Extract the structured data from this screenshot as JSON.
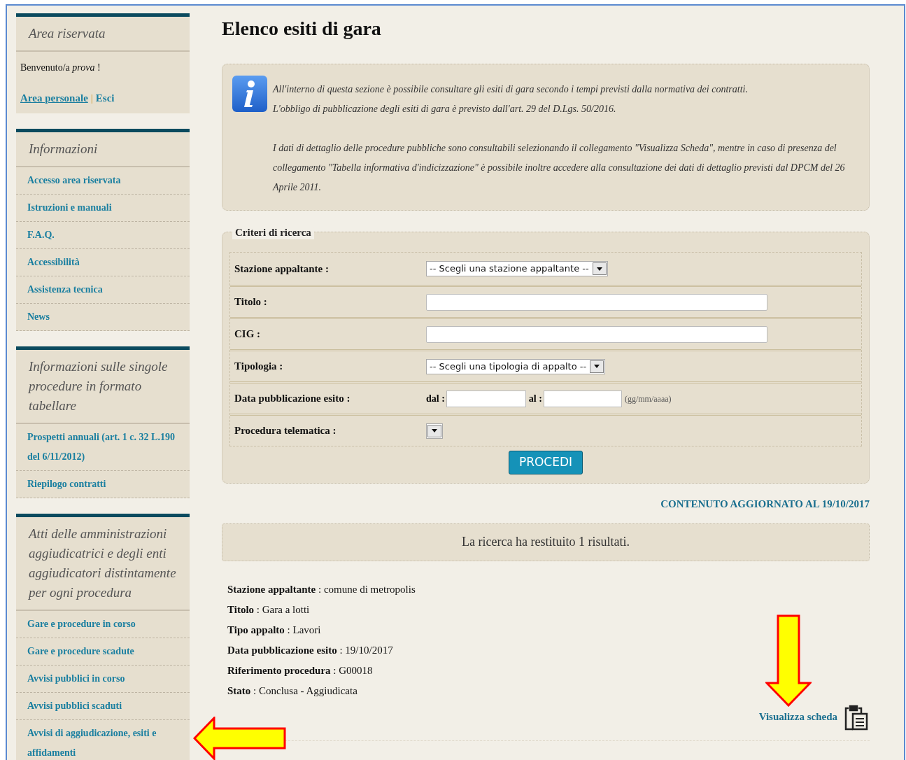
{
  "sidebar": {
    "panels": [
      {
        "kind": "login",
        "title": "Area riservata",
        "welcome": "Benvenuto/a *prova* !",
        "links": [
          "Area personale",
          "Esci"
        ],
        "separator": "|"
      },
      {
        "kind": "menu",
        "title": "Informazioni",
        "items": [
          "Accesso area riservata",
          "Istruzioni e manuali",
          "F.A.Q.",
          "Accessibilità",
          "Assistenza tecnica",
          "News"
        ]
      },
      {
        "kind": "menu",
        "title": "Informazioni sulle singole procedure in formato tabellare",
        "items": [
          "Prospetti annuali (art. 1 c. 32 L.190 del 6/11/2012)",
          "Riepilogo contratti"
        ]
      },
      {
        "kind": "menu",
        "title": "Atti delle amministrazioni aggiudicatrici e degli enti aggiudicatori distintamente per ogni procedura",
        "items": [
          "Gare e procedure in corso",
          "Gare e procedure scadute",
          "Avvisi pubblici in corso",
          "Avvisi pubblici scaduti",
          "Avvisi di aggiudicazione, esiti e affidamenti"
        ]
      }
    ]
  },
  "page_title": "Elenco esiti di gara",
  "info": {
    "paragraphs": [
      "All'interno di questa sezione è possibile consultare gli esiti di gara secondo i tempi previsti dalla normativa dei contratti.\nL'obbligo di pubblicazione degli esiti di gara è previsto dall'art. 29 del D.Lgs. 50/2016.",
      "I dati di dettaglio delle procedure pubbliche sono consultabili selezionando il collegamento \"Visualizza Scheda\", mentre in caso di presenza del collegamento \"Tabella informativa d'indicizzazione\" è possibile inoltre accedere alla consultazione dei dati di dettaglio previsti dal DPCM del 26 Aprile 2011."
    ]
  },
  "search_form": {
    "legend": "Criteri di ricerca",
    "fields": [
      {
        "kind": "select",
        "label": "Stazione appaltante :",
        "value": "-- Scegli una stazione appaltante --"
      },
      {
        "kind": "text",
        "label": "Titolo :"
      },
      {
        "kind": "text",
        "label": "CIG :"
      },
      {
        "kind": "select",
        "label": "Tipologia :",
        "value": "-- Scegli una tipologia di appalto --"
      },
      {
        "kind": "daterange",
        "label": "Data pubblicazione esito :",
        "from_label": "dal :",
        "to_label": "al :",
        "hint": "(gg/mm/aaaa)"
      },
      {
        "kind": "select",
        "label": "Procedura telematica :"
      }
    ],
    "button": "PROCEDI"
  },
  "updated_note": "CONTENUTO AGGIORNATO AL 19/10/2017",
  "result_message": "La ricerca ha restituito 1 risultati.",
  "result": {
    "fields": [
      "**Stazione appaltante** : comune di metropolis",
      "**Titolo** : Gara a lotti",
      "**Tipo appalto** : Lavori",
      "**Data pubblicazione esito** : 19/10/2017",
      "**Riferimento procedura** : G00018",
      "**Stato** : Conclusa - Aggiudicata"
    ],
    "link": "Visualizza scheda"
  }
}
